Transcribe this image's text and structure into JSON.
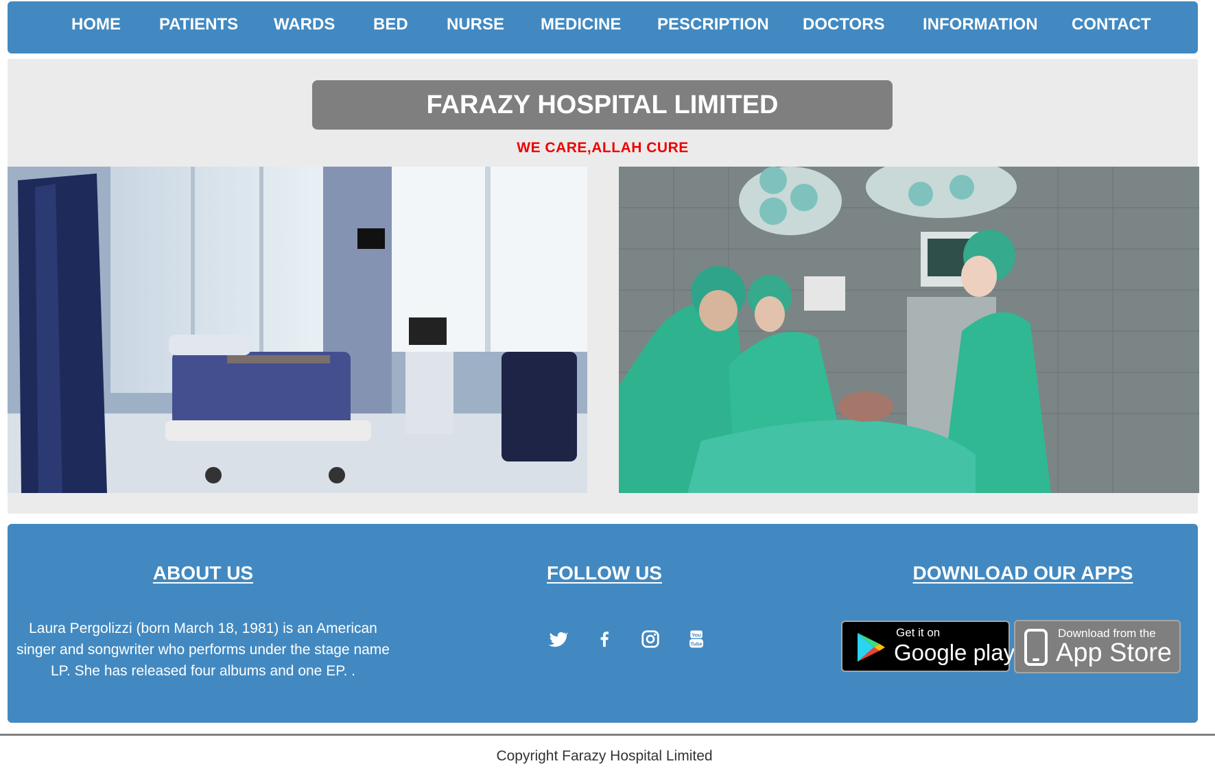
{
  "nav": {
    "items": [
      {
        "label": "HOME"
      },
      {
        "label": "PATIENTS"
      },
      {
        "label": "WARDS"
      },
      {
        "label": "BED"
      },
      {
        "label": "NURSE"
      },
      {
        "label": "MEDICINE"
      },
      {
        "label": "PESCRIPTION"
      },
      {
        "label": "DOCTORS"
      },
      {
        "label": "INFORMATION"
      },
      {
        "label": "CONTACT"
      }
    ]
  },
  "header": {
    "title": "FARAZY HOSPITAL LIMITED",
    "tagline": "WE CARE,ALLAH CURE"
  },
  "images": [
    {
      "name": "hospital-room-photo"
    },
    {
      "name": "operating-room-photo"
    }
  ],
  "footer": {
    "about": {
      "heading": "ABOUT US",
      "text": "Laura Pergolizzi (born March 18, 1981) is an American singer and songwriter who performs under the stage name LP. She has released four albums and one EP. ."
    },
    "follow": {
      "heading": "FOLLOW US",
      "icons": [
        "twitter-icon",
        "facebook-icon",
        "instagram-icon",
        "youtube-icon"
      ]
    },
    "apps": {
      "heading": "DOWNLOAD OUR APPS",
      "google_small": "Get it on",
      "google_big": "Google play",
      "apple_small": "Download from the",
      "apple_big": "App Store"
    }
  },
  "copyright": "Copyright Farazy Hospital Limited",
  "colors": {
    "primary": "#4289c1",
    "title_bg": "#7f7f7f",
    "tagline": "#ee0000",
    "panel_bg": "#ebebeb"
  }
}
